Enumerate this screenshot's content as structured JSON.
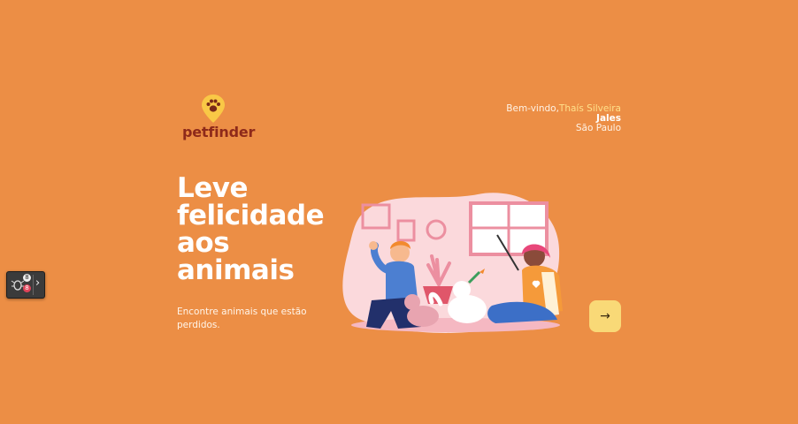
{
  "brand": {
    "name": "petfinder",
    "logo_icon": "paw-pin-icon"
  },
  "user": {
    "greeting": "Bem-vindo,",
    "name": "Thaís Silveira",
    "city": "Jales",
    "state": "São Paulo"
  },
  "hero": {
    "title_lines": [
      "Leve",
      "felicidade",
      "aos",
      "animais"
    ],
    "subtitle": "Encontre animais que estão perdidos."
  },
  "illustration": {
    "icon": "people-with-pets-illustration"
  },
  "next_button": {
    "symbol": "→",
    "icon": "arrow-right-icon"
  },
  "devtools": {
    "icon": "bug-icon",
    "toggle": "›",
    "badges": [
      "8",
      "8"
    ]
  },
  "colors": {
    "background": "#EC8E45",
    "accent": "#F9D977",
    "brand": "#8E2A1A",
    "highlight": "#FFE08A"
  }
}
